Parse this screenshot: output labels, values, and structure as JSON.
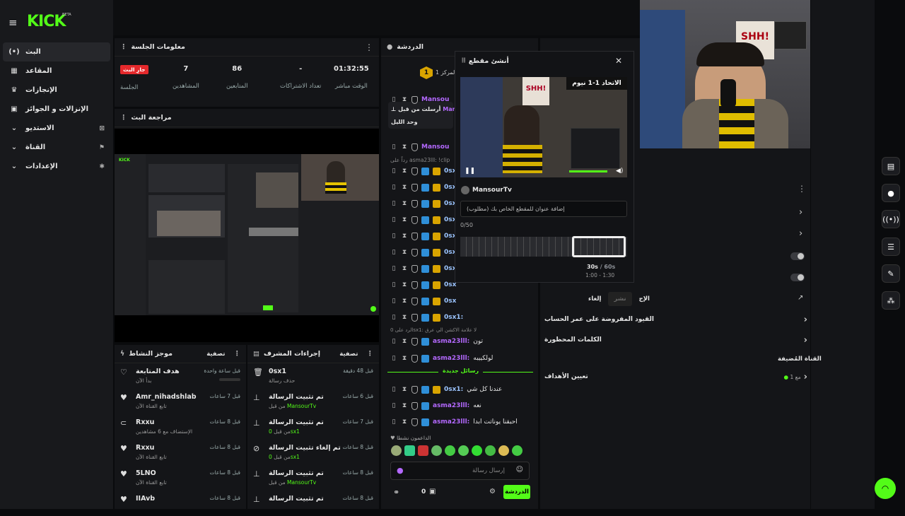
{
  "brand": {
    "logo": "KICK",
    "beta": "BETA"
  },
  "nav": {
    "items": [
      {
        "label": "البث",
        "icon": "live-icon"
      },
      {
        "label": "المقاعد",
        "icon": "dashboard-icon"
      },
      {
        "label": "الإنجازات",
        "icon": "trophy-icon"
      },
      {
        "label": "الإنزالات و الجوائز",
        "icon": "gift-icon"
      },
      {
        "label": "الاستديو",
        "icon": "studio-icon"
      },
      {
        "label": "القناة",
        "icon": "channel-icon"
      },
      {
        "label": "الإعدادات",
        "icon": "settings-icon"
      }
    ]
  },
  "session": {
    "title": "معلومات الجلسة",
    "badge": "جارِ البث",
    "badge_label": "الجلسة",
    "stats": [
      {
        "value": "7",
        "label": "المشاهدين"
      },
      {
        "value": "86",
        "label": "المتابعين"
      },
      {
        "value": "-",
        "label": "تعداد الاشتراكات"
      },
      {
        "value": "01:32:55",
        "label": "الوقت مباشر"
      }
    ]
  },
  "review": {
    "title": "مراجعة البث"
  },
  "activity": {
    "title": "موجز النشاط",
    "filter": "تصفية",
    "items": [
      {
        "icon": "heart-outline-icon",
        "title": "هدف المتابعة",
        "sub": "بدأ الآن",
        "time": "قبل ساعة واحدة"
      },
      {
        "icon": "heart-icon",
        "title": "Amr_nihadshlab",
        "sub": "تابع القناة الآن",
        "time": "قبل 7 ساعات"
      },
      {
        "icon": "raid-icon",
        "title": "Rxxu",
        "sub": "الإستضاف مع 6 مشاهدين",
        "time": "قبل 8 ساعات"
      },
      {
        "icon": "heart-icon",
        "title": "Rxxu",
        "sub": "تابع القناة الآن",
        "time": "قبل 8 ساعات"
      },
      {
        "icon": "heart-icon",
        "title": "5LNO",
        "sub": "تابع القناة الآن",
        "time": "قبل 8 ساعات"
      },
      {
        "icon": "heart-icon",
        "title": "IIAvb",
        "sub": "",
        "time": "قبل 8 ساعات"
      }
    ]
  },
  "modactions": {
    "title": "إجراءات المشرف",
    "filter": "تصفية",
    "items": [
      {
        "icon": "trash-icon",
        "title": "0sx1",
        "sub": "حذف رسالة",
        "time": "قبل 48 دقيقة"
      },
      {
        "icon": "pin-icon",
        "title": "تم تثبيت الرسالة",
        "sub": "MansourTv",
        "sub_prefix": "من قبل",
        "time": "قبل 6 ساعات"
      },
      {
        "icon": "pin-icon",
        "title": "تم تثبيت الرسالة",
        "sub": "0sx1",
        "sub_prefix": "من قبل",
        "time": "قبل 7 ساعات"
      },
      {
        "icon": "unpin-icon",
        "title": "تم إلغاء تثبيت الرسالة",
        "sub": "0sx1",
        "sub_prefix": "من قبل",
        "time": "قبل 8 ساعات"
      },
      {
        "icon": "pin-icon",
        "title": "تم تثبيت الرسالة",
        "sub": "MansourTv",
        "sub_prefix": "من قبل",
        "time": "قبل 8 ساعات"
      },
      {
        "icon": "pin-icon",
        "title": "تم تثبيت الرسالة",
        "sub": "",
        "sub_prefix": "",
        "time": "قبل 8 ساعات"
      }
    ]
  },
  "chat": {
    "title": "الدردشة",
    "rank": "المركز 1",
    "pinned_by": "أرسلت من قبل",
    "pinned_user": "Mansou",
    "pinned_text": "وحد الليل",
    "reply": "asma23lll: !clip",
    "reply_prefix": "رداً على",
    "new_messages": "رسائل جديدة",
    "rows": [
      {
        "user": "Mansou",
        "text": ""
      },
      {
        "user": "0sx",
        "text": ""
      },
      {
        "user": "0sx",
        "text": ""
      },
      {
        "user": "0sx",
        "text": ""
      },
      {
        "user": "0sx",
        "text": ""
      },
      {
        "user": "0sx",
        "text": ""
      },
      {
        "user": "0sx",
        "text": ""
      },
      {
        "user": "0sx",
        "text": ""
      },
      {
        "user": "0sx",
        "text": ""
      },
      {
        "user": "0sx",
        "text": ""
      }
    ],
    "reply2": "الرد على 0sx1: لا علامة الاكشن الي عرق",
    "row_0sx1": "0sx1:",
    "row_asma1_user": "asma23lll:",
    "row_asma1_text": "تون",
    "row_asma2_user": "asma23lll:",
    "row_asma2_text": "لولكييبه",
    "after": [
      {
        "user": "0sx1:",
        "text": "عندنا كل شي",
        "color": "blue"
      },
      {
        "user": "asma23lll:",
        "text": "نعه",
        "color": "purple"
      },
      {
        "user": "asma23lll:",
        "text": "احبقنا يوناتت ابدا",
        "color": "purple"
      }
    ],
    "active": "الداعمون نشطا",
    "input_placeholder": "إرسال رسالة",
    "count": "0",
    "send": "الدردشة"
  },
  "clip": {
    "title": "أنشئ مقطع",
    "streamer": "MansourTv",
    "title_placeholder": "إضافة عنوان للمقطع الخاص بك (مطلوب)",
    "counter": "0/50",
    "duration": "30s",
    "duration_max": "60s",
    "range": "1:00 - 1:30",
    "video_overlay": "الاتحاد 1-1 نيوم"
  },
  "rightpanel": {
    "actions_title": "الإج",
    "cancel": "إلغاء",
    "publish": "نشر",
    "restrictions": "القيود المفروضة على عمر الحساب",
    "banned_words": "الكلمات المحظورة",
    "featured": "القناة المُضيفة",
    "goals": "تعيين الأهداف",
    "goals_status": "مع 1"
  },
  "colors": {
    "accent": "#53fc18",
    "live": "#e5292c",
    "purple": "#b469ff"
  }
}
